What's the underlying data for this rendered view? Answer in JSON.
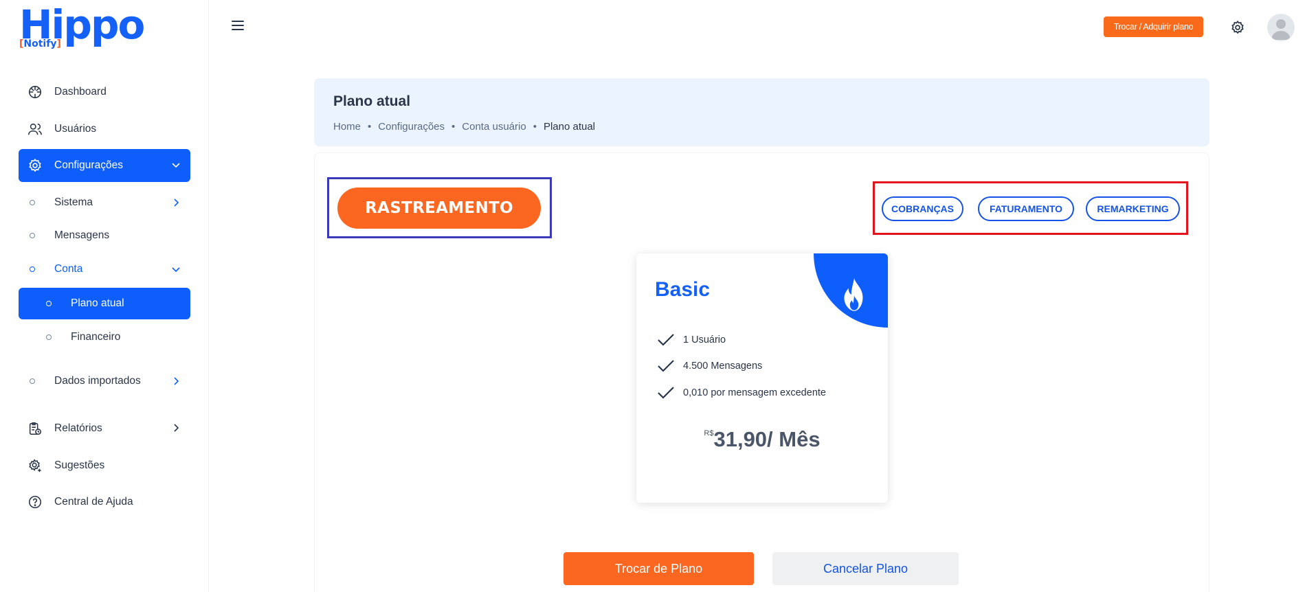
{
  "brand": {
    "name": "Hippo",
    "tagline_open": "[",
    "tagline": "Notify",
    "tagline_close": "]",
    "primary_color": "#1560f7",
    "accent_color": "#f05a28"
  },
  "sidebar": {
    "items": [
      {
        "label": "Dashboard",
        "icon": "dashboard-icon"
      },
      {
        "label": "Usuários",
        "icon": "users-icon"
      },
      {
        "label": "Configurações",
        "icon": "settings-icon",
        "active": true,
        "expanded": true
      },
      {
        "label": "Relatórios",
        "icon": "reports-icon"
      },
      {
        "label": "Sugestões",
        "icon": "suggestions-icon"
      },
      {
        "label": "Central de Ajuda",
        "icon": "help-icon"
      }
    ],
    "config_sub": {
      "sistema": "Sistema",
      "mensagens": "Mensagens",
      "conta": "Conta",
      "plano_atual": "Plano atual",
      "financeiro": "Financeiro",
      "dados_importados": "Dados importados"
    }
  },
  "topbar": {
    "plan_button": "Trocar / Adquirir plano"
  },
  "header": {
    "title": "Plano atual",
    "breadcrumb": [
      "Home",
      "Configurações",
      "Conta usuário",
      "Plano atual"
    ],
    "separator": "•"
  },
  "modules": {
    "active": "RASTREAMENTO",
    "others": [
      "COBRANÇAS",
      "FATURAMENTO",
      "REMARKETING"
    ]
  },
  "plan": {
    "name": "Basic",
    "features": [
      "1 Usuário",
      "4.500 Mensagens",
      "0,010 por mensagem excedente"
    ],
    "currency": "R$",
    "price": "31,90/ Mês"
  },
  "actions": {
    "change": "Trocar de Plano",
    "cancel": "Cancelar Plano"
  }
}
